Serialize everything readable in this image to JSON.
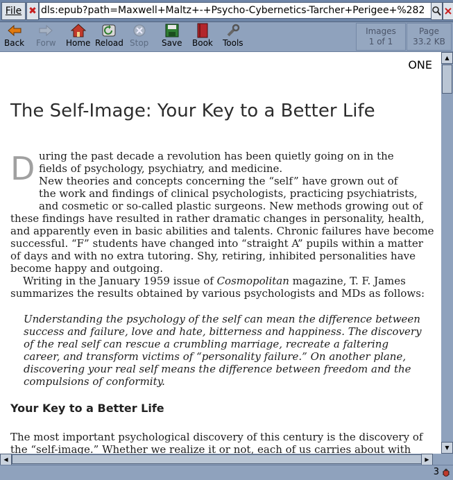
{
  "urlbar": {
    "file_menu": "File",
    "url": "dls:epub?path=Maxwell+Maltz+-+Psycho-Cybernetics-Tarcher+Perigee+%282"
  },
  "toolbar": {
    "back": "Back",
    "forward": "Forw",
    "home": "Home",
    "reload": "Reload",
    "stop": "Stop",
    "save": "Save",
    "book": "Book",
    "tools": "Tools",
    "images_label": "Images",
    "images_value": "1 of 1",
    "page_label": "Page",
    "page_value": "33.2 KB"
  },
  "document": {
    "chapter": "ONE",
    "title": "The Self-Image: Your Key to a Better Life",
    "dropcap": "D",
    "p1_line1": "uring the past decade a revolution has been quietly going on in the",
    "p1_line2": "fields of psychology, psychiatry, and medicine.",
    "p2_line1": "New theories and concepts concerning the “self” have grown out of",
    "p2_line2": "the work and findings of clinical psychologists, practicing psychiatrists,",
    "p2_line3": "and cosmetic or so-called plastic surgeons. New methods growing out of",
    "p2_rest": "these findings have resulted in rather dramatic changes in personality, health, and apparently even in basic abilities and talents. Chronic failures have become successful. “F” students have changed into “straight A” pupils within a matter of days and with no extra tutoring. Shy, retiring, inhibited personalities have become happy and outgoing.",
    "p3_start": "Writing in the January 1959 issue of ",
    "p3_magazine": "Cosmopolitan",
    "p3_end": " magazine, T. F. James summarizes the results obtained by various psychologists and MDs as follows:",
    "quote": "Understanding the psychology of the self can mean the difference between success and failure, love and hate, bitterness and happiness. The discovery of the real self can rescue a crumbling marriage, recreate a faltering career, and transform victims of “personality failure.” On another plane, discovering your real self means the difference between freedom and the compulsions of conformity.",
    "subheading": "Your Key to a Better Life",
    "p4": "The most important psychological discovery of this century is the discovery of the “self-image.” Whether we realize it or not, each of us carries about with"
  },
  "status": {
    "count": "3"
  },
  "colors": {
    "chrome": "#8fa2bd",
    "url_bar": "#6f86a8",
    "dropcap": "#a0a0a0"
  },
  "icons": [
    "back-arrow-icon",
    "forward-arrow-icon",
    "home-icon",
    "reload-icon",
    "stop-icon",
    "save-disk-icon",
    "book-icon",
    "tools-wrench-icon",
    "search-icon",
    "bug-icon"
  ]
}
